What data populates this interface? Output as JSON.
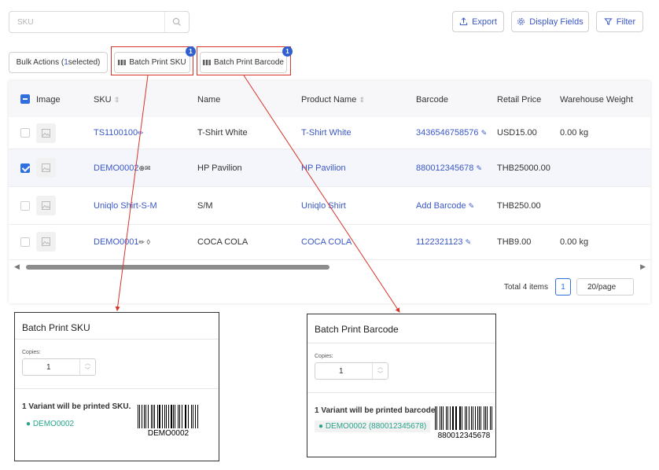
{
  "search": {
    "placeholder": "SKU"
  },
  "toolbar": {
    "export_label": "Export",
    "display_fields_label": "Display Fields",
    "filter_label": "Filter"
  },
  "bulk": {
    "prefix": "Bulk Actions (",
    "count": "1",
    "suffix": " selected)"
  },
  "print_buttons": {
    "sku_label": "Batch Print SKU",
    "barcode_label": "Batch Print Barcode",
    "badge_count": "1"
  },
  "table": {
    "headers": {
      "image": "Image",
      "sku": "SKU",
      "name": "Name",
      "product_name": "Product Name",
      "barcode": "Barcode",
      "retail_price": "Retail Price",
      "warehouse_weight": "Warehouse Weight"
    },
    "rows": [
      {
        "selected": false,
        "sku": "TS1100100",
        "name": "T-Shirt White",
        "product_name": "T-Shirt White",
        "barcode": "3436546758576",
        "retail_price": "USD15.00",
        "weight": "0.00 kg"
      },
      {
        "selected": true,
        "sku": "DEMO0002",
        "name": "HP Pavilion",
        "product_name": "HP Pavilion",
        "barcode": "880012345678",
        "retail_price": "THB25000.00",
        "weight": ""
      },
      {
        "selected": false,
        "sku": "Uniqlo Shirt-S-M",
        "name": "S/M",
        "product_name": "Uniqlo Shirt",
        "barcode": "Add Barcode",
        "retail_price": "THB250.00",
        "weight": ""
      },
      {
        "selected": false,
        "sku": "DEMO0001",
        "name": "COCA COLA",
        "product_name": "COCA COLA",
        "barcode": "1122321123",
        "retail_price": "THB9.00",
        "weight": "0.00 kg"
      }
    ]
  },
  "pagination": {
    "total": "Total 4 items",
    "current_page": "1",
    "page_size": "20/page"
  },
  "sku_panel": {
    "title": "Batch Print SKU",
    "copies_label": "Copies:",
    "copies_value": "1",
    "message": "1 Variant will be printed SKU.",
    "variant": "DEMO0002",
    "barcode_text": "DEMO0002"
  },
  "barcode_panel": {
    "title": "Batch Print Barcode",
    "copies_label": "Copies:",
    "copies_value": "1",
    "message": "1 Variant will be printed barcode.",
    "variant": "DEMO0002 (880012345678)",
    "barcode_text": "880012345678"
  },
  "colors": {
    "accent": "#3a57c8",
    "checkbox": "#2f6fde",
    "variant_green": "#28a48a",
    "annotation_red": "#d9342b"
  }
}
